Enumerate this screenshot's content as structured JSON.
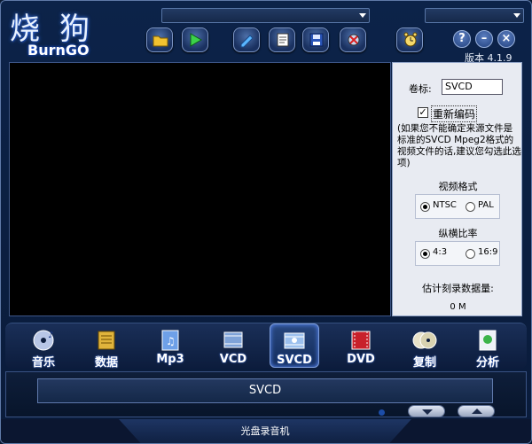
{
  "app": {
    "logo_cn": "烧狗",
    "logo_en": "BurnGO",
    "version": "版本 4.1.9"
  },
  "toolbar": {
    "combo1_value": "",
    "combo2_value": "",
    "buttons": [
      "open-icon",
      "play-icon",
      "edit-icon",
      "document-icon",
      "save-icon",
      "tools-icon",
      "timer-icon"
    ]
  },
  "window_buttons": {
    "help": "?",
    "minimize": "–",
    "close": "×"
  },
  "panel": {
    "volume_label": "卷标:",
    "volume_value": "SVCD",
    "reencode_checked": true,
    "reencode_label": "重新编码",
    "note": "(如果您不能确定来源文件是标准的SVCD Mpeg2格式的视频文件的话,建议您勾选此选项)",
    "video_format_title": "视频格式",
    "video_format_options": [
      "NTSC",
      "PAL"
    ],
    "video_format_selected": "NTSC",
    "aspect_title": "纵横比率",
    "aspect_options": [
      "4:3",
      "16:9"
    ],
    "aspect_selected": "4:3",
    "estimate_label": "估计刻录数据量:",
    "estimate_value": "0 M"
  },
  "categories": [
    {
      "label": "音乐",
      "icon": "music-disc-icon"
    },
    {
      "label": "数据",
      "icon": "data-icon"
    },
    {
      "label": "Mp3",
      "icon": "mp3-icon"
    },
    {
      "label": "VCD",
      "icon": "vcd-icon"
    },
    {
      "label": "SVCD",
      "icon": "svcd-icon",
      "active": true
    },
    {
      "label": "DVD",
      "icon": "dvd-icon"
    },
    {
      "label": "复制",
      "icon": "copy-disc-icon"
    },
    {
      "label": "分析",
      "icon": "analyze-icon"
    }
  ],
  "status": {
    "text": "SVCD"
  },
  "footer": {
    "text": "光盘录音机"
  },
  "colors": {
    "frame": "#0c2349",
    "panel": "#e8ebf2",
    "preview": "#000000",
    "accent": "#5b8cff"
  }
}
